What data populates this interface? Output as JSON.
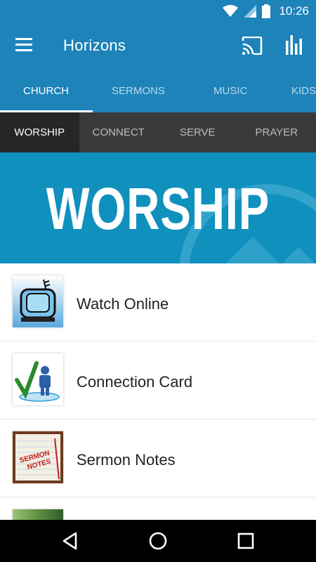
{
  "status_bar": {
    "time": "10:26",
    "icons": [
      "wifi-icon",
      "signal-icon",
      "battery-icon"
    ]
  },
  "app_bar": {
    "title": "Horizons",
    "icons": [
      "menu-icon",
      "cast-icon",
      "stats-icon"
    ]
  },
  "main_tabs": [
    {
      "label": "CHURCH",
      "active": true
    },
    {
      "label": "SERMONS",
      "active": false
    },
    {
      "label": "MUSIC",
      "active": false
    },
    {
      "label": "KIDS",
      "active": false
    }
  ],
  "sub_tabs": [
    {
      "label": "WORSHIP",
      "active": true
    },
    {
      "label": "CONNECT",
      "active": false
    },
    {
      "label": "SERVE",
      "active": false
    },
    {
      "label": "PRAYER",
      "active": false
    }
  ],
  "banner": {
    "title": "WORSHIP"
  },
  "list": [
    {
      "label": "Watch Online",
      "icon": "tv-icon"
    },
    {
      "label": "Connection Card",
      "icon": "checkmark-person-icon"
    },
    {
      "label": "Sermon Notes",
      "icon": "notepad-icon",
      "icon_text": "SERMON NOTES"
    },
    {
      "label": "",
      "icon": "partial-image-icon"
    }
  ],
  "nav_bar": {
    "icons": [
      "back-icon",
      "home-icon",
      "recents-icon"
    ]
  },
  "colors": {
    "primary": "#1d83b9",
    "banner": "#0f90bd",
    "sub_tab_bg": "#3a3a3a",
    "sub_tab_active": "#262626"
  }
}
